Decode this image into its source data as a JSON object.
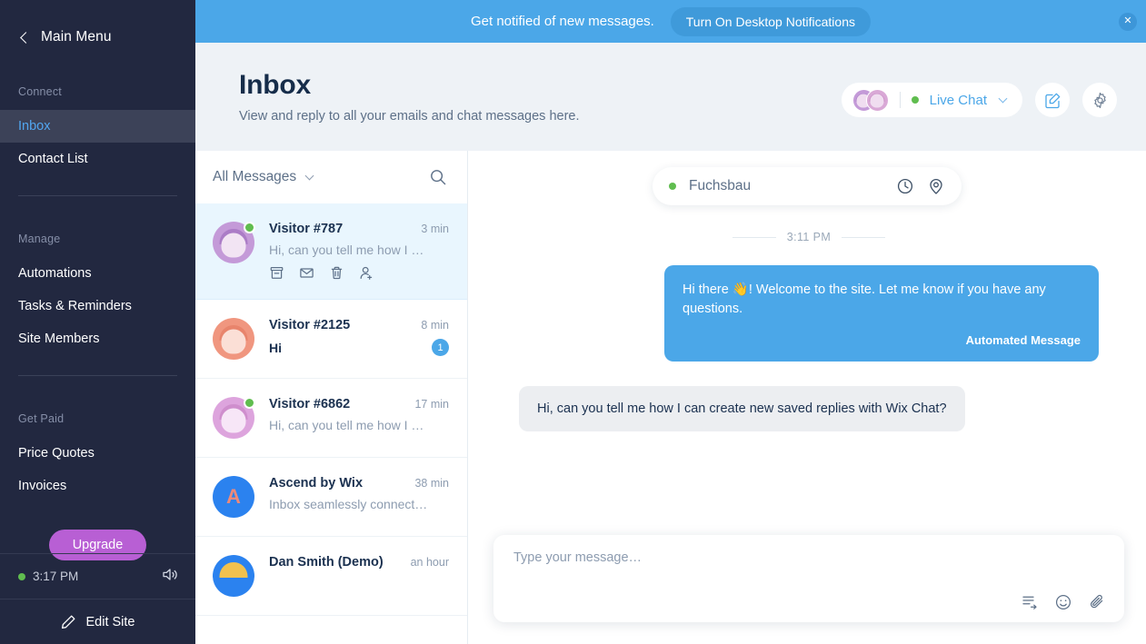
{
  "sidebar": {
    "main_menu": "Main Menu",
    "back_icon": "chevron-left-icon",
    "sections": [
      {
        "label": "Connect",
        "items": [
          {
            "label": "Inbox",
            "active": true
          },
          {
            "label": "Contact List",
            "active": false
          }
        ]
      },
      {
        "label": "Manage",
        "items": [
          {
            "label": "Automations",
            "active": false
          },
          {
            "label": "Tasks & Reminders",
            "active": false
          },
          {
            "label": "Site Members",
            "active": false
          }
        ]
      },
      {
        "label": "Get Paid",
        "items": [
          {
            "label": "Price Quotes",
            "active": false
          },
          {
            "label": "Invoices",
            "active": false
          }
        ]
      }
    ],
    "upgrade_label": "Upgrade",
    "status_time": "3:17 PM",
    "speaker_icon": "speaker-icon",
    "edit_site_label": "Edit Site",
    "edit_icon": "pencil-icon",
    "bg_color": "#222840",
    "active_color": "#3c4258",
    "active_text_color": "#52a6f0",
    "upgrade_color": "#b85fd4"
  },
  "banner": {
    "text": "Get notified of new messages.",
    "button_label": "Turn On Desktop Notifications",
    "close_icon": "close-icon",
    "bg_color": "#4ba7e8"
  },
  "header": {
    "title": "Inbox",
    "subtitle": "View and reply to all your emails and chat messages here.",
    "chat_status_label": "Live Chat",
    "chat_status_dot_color": "#60bd4f",
    "chevron_icon": "chevron-down-icon",
    "compose_icon": "compose-icon",
    "settings_icon": "gear-icon"
  },
  "list": {
    "filter_label": "All Messages",
    "filter_chevron_icon": "chevron-down-icon",
    "search_icon": "search-icon",
    "conversations": [
      {
        "name": "Visitor #787",
        "time": "3 min",
        "preview": "Hi, can you tell me how I …",
        "selected": true,
        "online": true,
        "unread": 0,
        "avatar_type": "purple",
        "actions": [
          "archive-icon",
          "mail-icon",
          "trash-icon",
          "add-contact-icon"
        ]
      },
      {
        "name": "Visitor #2125",
        "time": "8 min",
        "preview": "Hi",
        "selected": false,
        "online": false,
        "unread": 1,
        "avatar_type": "orange",
        "actions": []
      },
      {
        "name": "Visitor #6862",
        "time": "17 min",
        "preview": "Hi, can you tell me how I …",
        "selected": false,
        "online": true,
        "unread": 0,
        "avatar_type": "pink",
        "actions": []
      },
      {
        "name": "Ascend by Wix",
        "time": "38 min",
        "preview": "Inbox seamlessly connect…",
        "selected": false,
        "online": false,
        "unread": 0,
        "avatar_type": "letter",
        "avatar_letter": "A",
        "actions": []
      },
      {
        "name": "Dan Smith (Demo)",
        "time": "an hour",
        "preview": "",
        "selected": false,
        "online": false,
        "unread": 0,
        "avatar_type": "blue",
        "actions": []
      }
    ]
  },
  "chat": {
    "contact_name": "Fuchsbau",
    "status_dot_color": "#60bd4f",
    "history_icon": "clock-icon",
    "location_icon": "location-pin-icon",
    "time_separator": "3:11 PM",
    "messages": [
      {
        "direction": "out",
        "text": "Hi there 👋! Welcome to the site. Let me know if you have any questions.",
        "label": "Automated Message"
      },
      {
        "direction": "in",
        "text": "Hi, can you tell me how I can create new saved replies with Wix Chat?"
      }
    ],
    "composer_placeholder": "Type your message…",
    "composer_value": "",
    "composer_icons": [
      "saved-reply-icon",
      "emoji-icon",
      "attachment-icon"
    ]
  }
}
